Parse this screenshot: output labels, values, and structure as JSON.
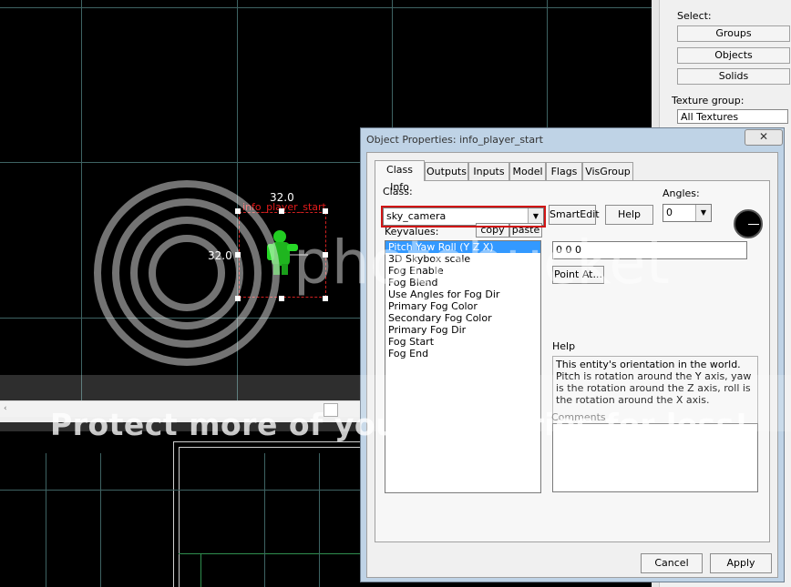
{
  "viewport": {
    "width_label": "32.0",
    "height_label": "32.0",
    "entity_label": "info_player_start"
  },
  "right_panel": {
    "select_label": "Select:",
    "buttons": [
      "Groups",
      "Objects",
      "Solids"
    ],
    "texture_group_label": "Texture group:",
    "texture_group_value": "All Textures"
  },
  "dialog": {
    "title": "Object Properties: info_player_start",
    "close_glyph": "✕",
    "tabs": [
      {
        "label": "Class Info",
        "active": true
      },
      {
        "label": "Outputs",
        "active": false
      },
      {
        "label": "Inputs",
        "active": false
      },
      {
        "label": "Model",
        "active": false
      },
      {
        "label": "Flags",
        "active": false
      },
      {
        "label": "VisGroup",
        "active": false
      }
    ],
    "class_label": "Class:",
    "class_value": "sky_camera",
    "smartedit_label": "SmartEdit",
    "help_button_label": "Help",
    "angles_label": "Angles:",
    "angles_value": "0",
    "keyvalues_label": "Keyvalues:",
    "copy_label": "copy",
    "paste_label": "paste",
    "keyvalues": [
      "Pitch Yaw Roll (Y Z X)",
      "3D Skybox scale",
      "Fog Enable",
      "Fog Blend",
      "Use Angles for Fog Dir",
      "Primary Fog Color",
      "Secondary Fog Color",
      "Primary Fog Dir",
      "Fog Start",
      "Fog End"
    ],
    "selected_keyvalue_index": 0,
    "value": "0 0 0",
    "point_at_label": "Point At...",
    "help_section_label": "Help",
    "help_text": "This entity's orientation in the world. Pitch is rotation around the Y axis, yaw is the rotation around the Z axis, roll is the rotation around the X axis.",
    "comments_label": "Comments",
    "comments_value": "",
    "cancel_label": "Cancel",
    "apply_label": "Apply"
  },
  "watermark": {
    "text": "Protect more of your memories for less!",
    "brand": "photobucket"
  },
  "colors": {
    "grid": "#3e6363",
    "selection": "#d02020",
    "entity": "#22cc22",
    "highlight_box": "#d01515",
    "list_selection": "#3399ff"
  }
}
